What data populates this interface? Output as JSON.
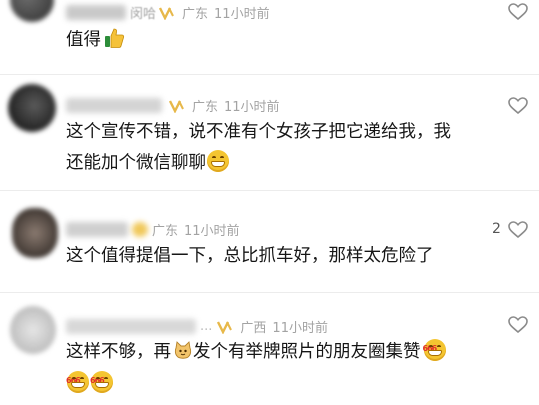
{
  "comments": [
    {
      "name_visible": "闵哈",
      "location": "广东",
      "time": "11小时前",
      "text": "值得",
      "emoji": "thumbs-up-icon",
      "likes": ""
    },
    {
      "location": "广东",
      "time": "11小时前",
      "lines": [
        "这个宣传不错，说不准有个女孩子把它递给我，我",
        "还能加个微信聊聊"
      ],
      "emoji": "grinning-face-icon",
      "likes": ""
    },
    {
      "location": "广东",
      "time": "11小时前",
      "text": "这个值得提倡一下，总比抓车好，那样太危险了",
      "likes": "2"
    },
    {
      "location": "广西",
      "time": "11小时前",
      "text_before": "这样不够，再",
      "text_after": "发个有举牌照片的朋友圈集赞",
      "emoji_mid": "cat-face-icon",
      "emoji_end": "grinning-666-icon",
      "likes": ""
    }
  ],
  "colors": {
    "meta": "#a3a3a3",
    "text": "#161616",
    "badge": "#e7b84a"
  }
}
